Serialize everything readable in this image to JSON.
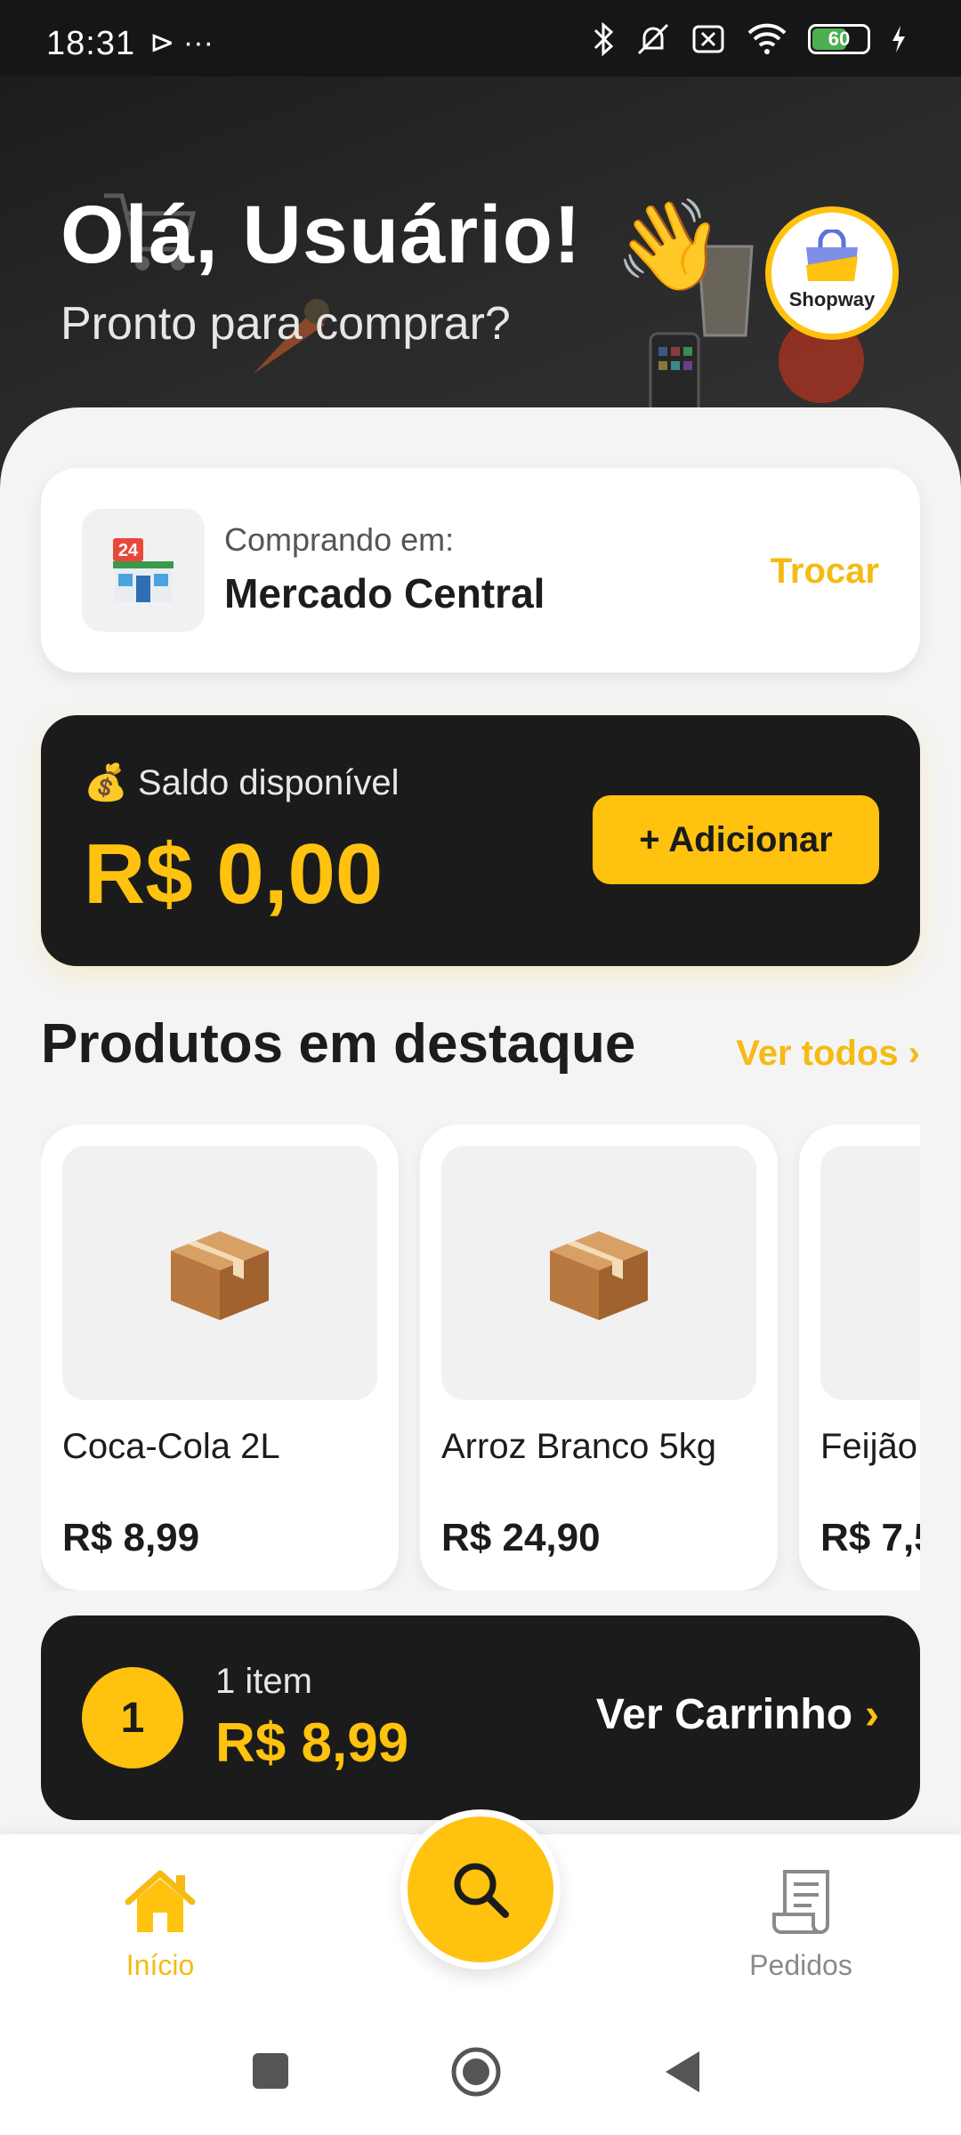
{
  "status_bar": {
    "time": "18:31",
    "left_icons": "⊳ ···",
    "battery": "60"
  },
  "header": {
    "greeting": "Olá, Usuário!",
    "subtitle": "Pronto para comprar?",
    "logo_text": "Shopway"
  },
  "store": {
    "label": "Comprando em:",
    "name": "Mercado Central",
    "switch_label": "Trocar"
  },
  "balance": {
    "label": "💰 Saldo disponível",
    "value": "R$ 0,00",
    "add_label": "+ Adicionar"
  },
  "featured": {
    "title": "Produtos em destaque",
    "see_all": "Ver todos ›",
    "products": [
      {
        "name": "Coca-Cola 2L",
        "price": "R$ 8,99"
      },
      {
        "name": "Arroz Branco 5kg",
        "price": "R$ 24,90"
      },
      {
        "name": "Feijão",
        "price": "R$ 7,5"
      }
    ]
  },
  "cart": {
    "count": "1",
    "items_label": "1 item",
    "total": "R$ 8,99",
    "view_label": "Ver Carrinho",
    "view_chevron": "›"
  },
  "nav": {
    "home": "Início",
    "orders": "Pedidos"
  },
  "colors": {
    "accent": "#FFC20E",
    "dark": "#1b1b1b",
    "background": "#f4f4f4"
  }
}
